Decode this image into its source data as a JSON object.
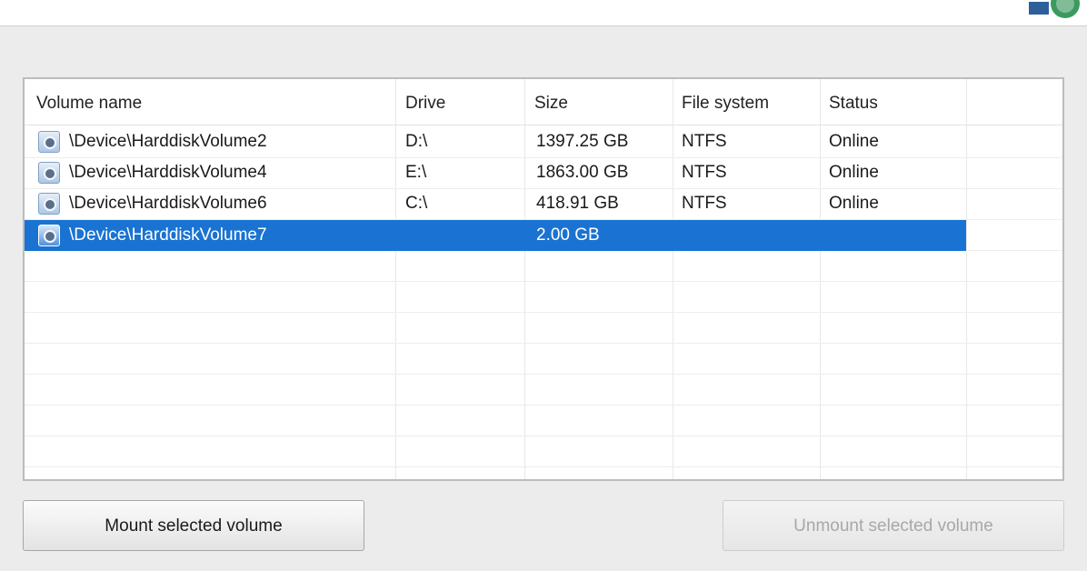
{
  "volumes_panel": {
    "columns": [
      "Volume name",
      "Drive",
      "Size",
      "File system",
      "Status"
    ],
    "rows": [
      {
        "volume_name": "\\Device\\HarddiskVolume2",
        "drive": "D:\\",
        "size": "1397.25 GB",
        "file_system": "NTFS",
        "status": "Online",
        "selected": false
      },
      {
        "volume_name": "\\Device\\HarddiskVolume4",
        "drive": "E:\\",
        "size": "1863.00 GB",
        "file_system": "NTFS",
        "status": "Online",
        "selected": false
      },
      {
        "volume_name": "\\Device\\HarddiskVolume6",
        "drive": "C:\\",
        "size": "418.91 GB",
        "file_system": "NTFS",
        "status": "Online",
        "selected": false
      },
      {
        "volume_name": "\\Device\\HarddiskVolume7",
        "drive": "",
        "size": "2.00 GB",
        "file_system": "",
        "status": "",
        "selected": true
      }
    ]
  },
  "buttons": {
    "mount_label": "Mount selected volume",
    "unmount_label": "Unmount selected volume",
    "unmount_enabled": false
  },
  "icons": {
    "row_icon": "volume-disk-icon",
    "header_icon": "app-logo-icon"
  },
  "colors": {
    "selection": "#1a73d2",
    "window_bg": "#ececec",
    "logo_green": "#3c9a5f",
    "logo_blue": "#2f5f9b"
  }
}
